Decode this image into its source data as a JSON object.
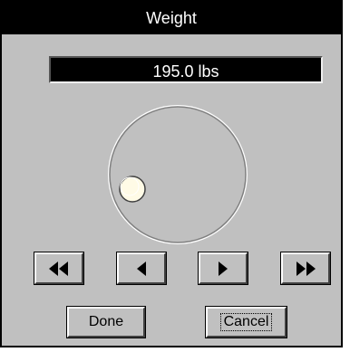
{
  "dialog": {
    "title": "Weight",
    "value_display": "195.0 lbs"
  },
  "dial": {
    "knob_color": "#fffbe6",
    "track_color": "#808080"
  },
  "nav_buttons": [
    {
      "icon": "fast-rewind-icon"
    },
    {
      "icon": "step-back-icon"
    },
    {
      "icon": "step-forward-icon"
    },
    {
      "icon": "fast-forward-icon"
    }
  ],
  "actions": {
    "done_label": "Done",
    "cancel_label": "Cancel"
  }
}
